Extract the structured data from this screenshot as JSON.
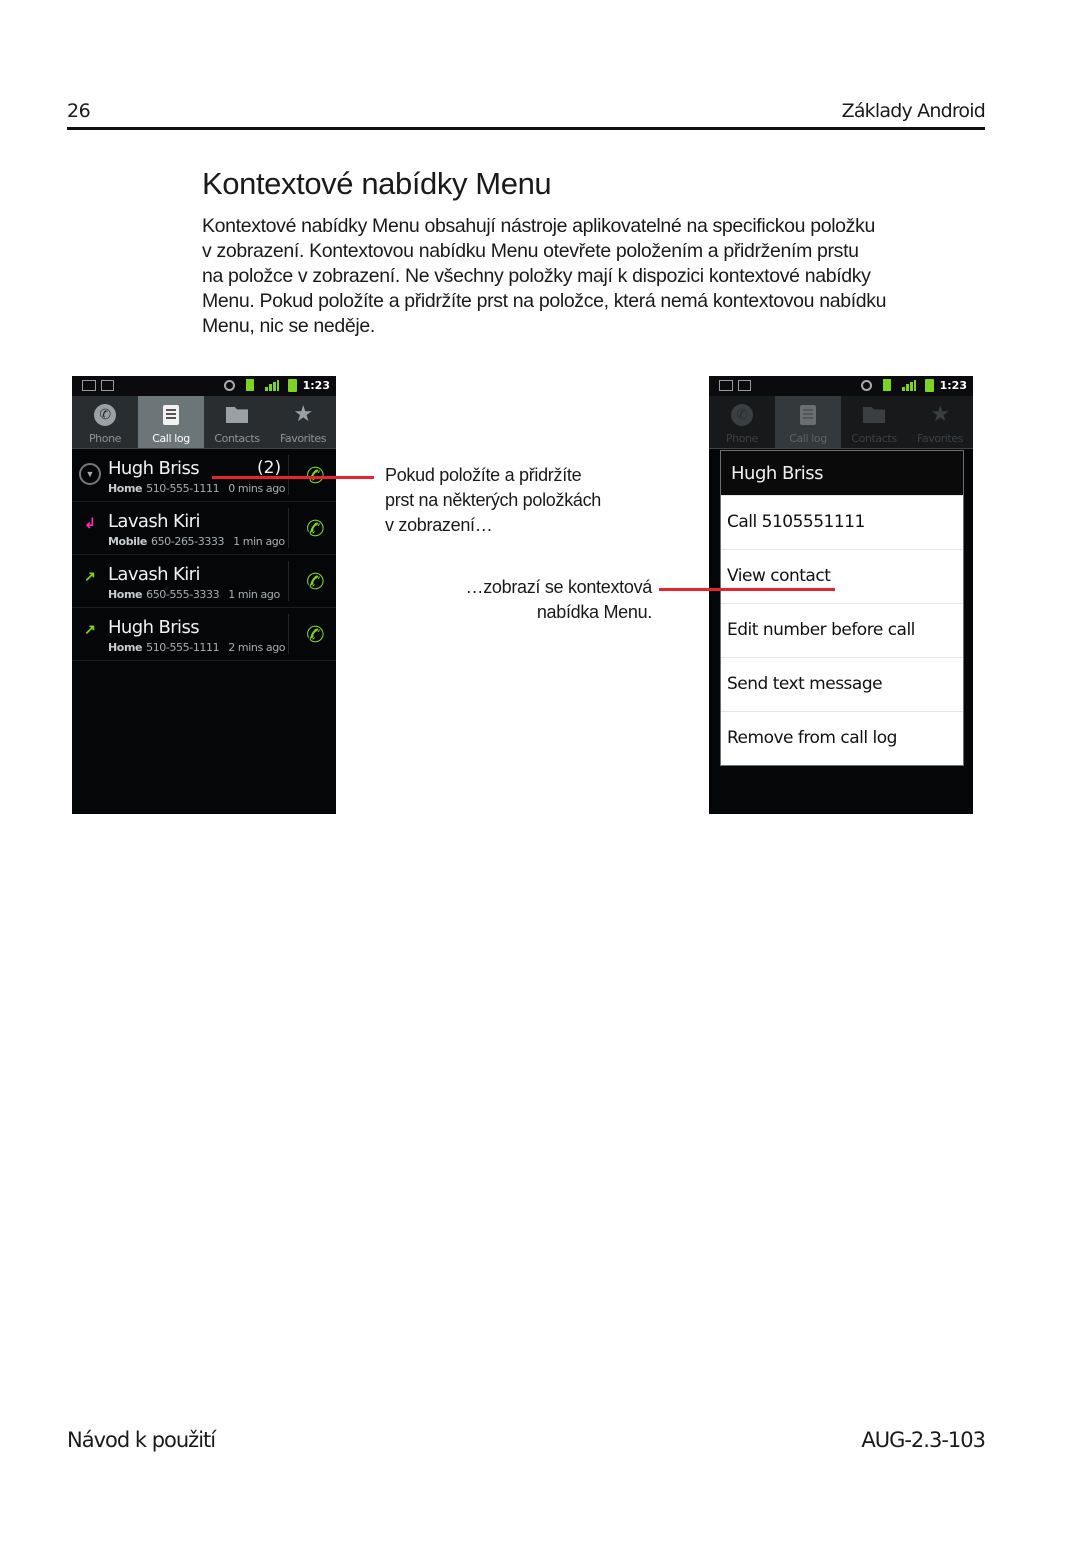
{
  "header": {
    "page_number": "26",
    "running_head": "Základy Android"
  },
  "section": {
    "title": "Kontextové nabídky Menu",
    "paragraph_lines": [
      "Kontextové nabídky Menu obsahují nástroje aplikovatelné na specifickou položku",
      "v zobrazení. Kontextovou nabídku Menu otevřete položením a přidržením prstu",
      "na položce v zobrazení. Ne všechny položky mají k dispozici kontextové nabídky",
      "Menu. Pokud položíte a přidržíte prst na položce, která nemá kontextovou nabídku",
      "Menu, nic se neděje."
    ]
  },
  "phone_left": {
    "status_time": "1:23",
    "tabs": [
      {
        "label": "Phone",
        "icon": "phone-icon"
      },
      {
        "label": "Call log",
        "icon": "call-log-icon",
        "active": true
      },
      {
        "label": "Contacts",
        "icon": "contacts-icon"
      },
      {
        "label": "Favorites",
        "icon": "star-icon"
      }
    ],
    "calls": [
      {
        "name": "Hugh Briss",
        "count": "(2)",
        "type": "Home",
        "number": "510-555-1111",
        "ago": "0 mins ago",
        "call_type_icon": "expand-icon"
      },
      {
        "name": "Lavash Kiri",
        "count": "",
        "type": "Mobile",
        "number": "650-265-3333",
        "ago": "1 min ago",
        "call_type_icon": "missed-call-icon"
      },
      {
        "name": "Lavash Kiri",
        "count": "",
        "type": "Home",
        "number": "650-555-3333",
        "ago": "1 min ago",
        "call_type_icon": "outgoing-call-icon"
      },
      {
        "name": "Hugh Briss",
        "count": "",
        "type": "Home",
        "number": "510-555-1111",
        "ago": "2 mins ago",
        "call_type_icon": "outgoing-call-icon"
      }
    ]
  },
  "phone_right": {
    "status_time": "1:23",
    "tabs": [
      {
        "label": "Phone"
      },
      {
        "label": "Call log",
        "active": true
      },
      {
        "label": "Contacts"
      },
      {
        "label": "Favorites"
      }
    ],
    "context_menu": {
      "title": "Hugh Briss",
      "items": [
        "Call 5105551111",
        "View contact",
        "Edit number before call",
        "Send text message",
        "Remove from call log"
      ]
    }
  },
  "callouts": {
    "left_lines": [
      "Pokud položíte a přidržíte",
      "prst na některých položkách",
      "v zobrazení…"
    ],
    "right_lines": [
      "…zobrazí se kontextová",
      "nabídka Menu."
    ],
    "line_color": "#e8232f"
  },
  "footer": {
    "left": "Návod k použití",
    "right": "AUG-2.3-103"
  }
}
